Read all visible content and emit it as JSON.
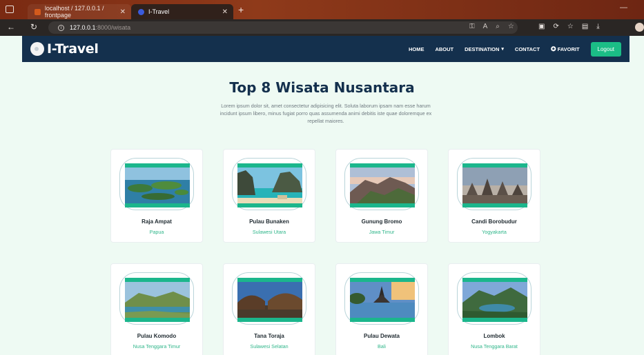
{
  "browser": {
    "tabs": [
      {
        "label": "localhost / 127.0.0.1 / frontpage"
      },
      {
        "label": "I-Travel"
      }
    ],
    "url_host": "127.0.0.1",
    "url_path": ":8000/wisata"
  },
  "navbar": {
    "logo_text": "I-Travel",
    "menu": {
      "home": "HOME",
      "about": "ABOUT",
      "destination": "DESTINATION",
      "contact": "CONTACT",
      "favorit": "FAVORIT"
    },
    "logout_label": "Logout"
  },
  "section": {
    "title": "Top 8 Wisata Nusantara",
    "description": "Lorem ipsum dolor sit, amet consectetur adipisicing elit. Soluta laborum ipsam nam esse harum incidunt ipsum libero, minus fugiat porro quas assumenda animi debitis iste quae doloremque ex repellat maiores."
  },
  "destinations": [
    {
      "name": "Raja Ampat",
      "location": "Papua"
    },
    {
      "name": "Pulau Bunaken",
      "location": "Sulawesi Utara"
    },
    {
      "name": "Gunung Bromo",
      "location": "Jawa Timur"
    },
    {
      "name": "Candi Borobudur",
      "location": "Yogyakarta"
    },
    {
      "name": "Pulau Komodo",
      "location": "Nusa Tenggara Timur"
    },
    {
      "name": "Tana Toraja",
      "location": "Sulawesi Selatan"
    },
    {
      "name": "Pulau Dewata",
      "location": "Bali"
    },
    {
      "name": "Lombok",
      "location": "Nusa Tenggara Barat"
    }
  ],
  "colors": {
    "navbar": "#14304d",
    "accent": "#1bbd86",
    "page_bg": "#eefaf3"
  }
}
